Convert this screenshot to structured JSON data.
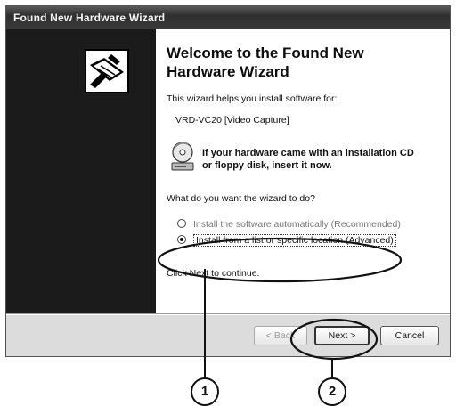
{
  "window": {
    "title": "Found New Hardware Wizard"
  },
  "content": {
    "heading_line1": "Welcome to the Found New",
    "heading_line2": "Hardware Wizard",
    "intro": "This wizard helps you install software for:",
    "device": "VRD-VC20 [Video Capture]",
    "cd_line1": "If your hardware came with an installation CD",
    "cd_line2": "or floppy disk, insert it now.",
    "question": "What do you want the wizard to do?",
    "options": [
      {
        "label": "Install the software automatically (Recommended)",
        "selected": false
      },
      {
        "label": "Install from a list or specific location (Advanced)",
        "selected": true
      }
    ],
    "continue": "Click Next to continue."
  },
  "buttons": {
    "back": "< Back",
    "next": "Next >",
    "cancel": "Cancel"
  },
  "callouts": {
    "one": "1",
    "two": "2"
  }
}
